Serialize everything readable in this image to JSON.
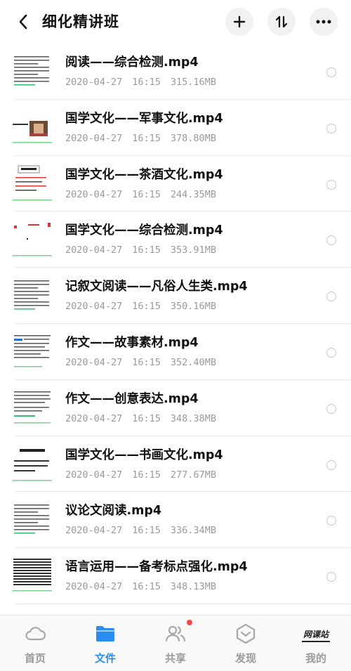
{
  "header": {
    "title": "细化精讲班",
    "back_icon": "chevron-left-icon",
    "add_icon": "plus-icon",
    "sort_icon": "sort-icon",
    "more_icon": "more-dots-icon"
  },
  "files": [
    {
      "name": "阅读——综合检测.mp4",
      "date": "2020-04-27",
      "time": "16:15",
      "size": "315.16MB",
      "thumb": "doc"
    },
    {
      "name": "国学文化——军事文化.mp4",
      "date": "2020-04-27",
      "time": "16:15",
      "size": "378.80MB",
      "thumb": "photo"
    },
    {
      "name": "国学文化——茶酒文化.mp4",
      "date": "2020-04-27",
      "time": "16:15",
      "size": "244.35MB",
      "thumb": "slide"
    },
    {
      "name": "国学文化——综合检测.mp4",
      "date": "2020-04-27",
      "time": "16:15",
      "size": "353.91MB",
      "thumb": "sparse"
    },
    {
      "name": "记叙文阅读——凡俗人生类.mp4",
      "date": "2020-04-27",
      "time": "16:15",
      "size": "350.16MB",
      "thumb": "doc"
    },
    {
      "name": "作文——故事素材.mp4",
      "date": "2020-04-27",
      "time": "16:15",
      "size": "352.40MB",
      "thumb": "doc-hl"
    },
    {
      "name": "作文——创意表达.mp4",
      "date": "2020-04-27",
      "time": "16:15",
      "size": "348.38MB",
      "thumb": "doc-green"
    },
    {
      "name": "国学文化——书画文化.mp4",
      "date": "2020-04-27",
      "time": "16:15",
      "size": "277.67MB",
      "thumb": "text-slide"
    },
    {
      "name": "议论文阅读.mp4",
      "date": "2020-04-27",
      "time": "16:15",
      "size": "336.34MB",
      "thumb": "doc"
    },
    {
      "name": "语言运用——备考标点强化.mp4",
      "date": "2020-04-27",
      "time": "16:15",
      "size": "348.13MB",
      "thumb": "doc-dense"
    }
  ],
  "nav": [
    {
      "label": "首页",
      "icon": "cloud-icon",
      "active": false
    },
    {
      "label": "文件",
      "icon": "folder-icon",
      "active": true
    },
    {
      "label": "共享",
      "icon": "people-icon",
      "active": false,
      "badge": true
    },
    {
      "label": "发现",
      "icon": "discover-icon",
      "active": false
    },
    {
      "label": "我的",
      "icon": "profile-logo-icon",
      "active": false,
      "logo_text": "网课站"
    }
  ],
  "colors": {
    "accent": "#2b8cf2",
    "badge": "#f04a4a",
    "meta_text": "#9a9a9a"
  }
}
